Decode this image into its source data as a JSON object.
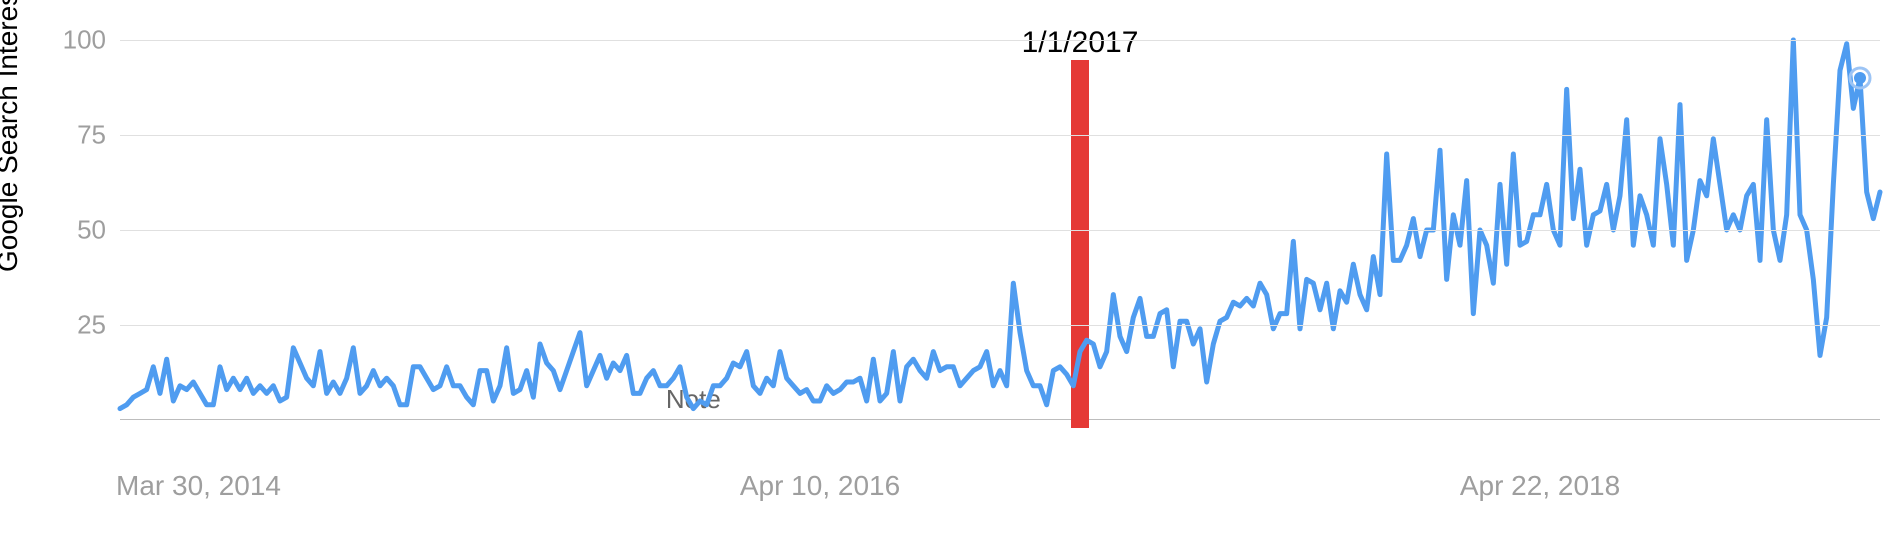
{
  "chart_data": {
    "type": "line",
    "title": "",
    "xlabel": "",
    "ylabel": "Google Search Interest",
    "ylim": [
      0,
      100
    ],
    "y_ticks": [
      25,
      50,
      75,
      100
    ],
    "x_tick_labels": [
      "Mar 30, 2014",
      "Apr 10, 2016",
      "Apr 22, 2018"
    ],
    "x_tick_indices": [
      0,
      105,
      213
    ],
    "note_label": "Note",
    "note_index": 86,
    "annotation": {
      "label": "1/1/2017",
      "index": 144
    },
    "colors": {
      "line": "#4f9cf0",
      "marker": "#e53935"
    },
    "values": [
      3,
      4,
      6,
      7,
      8,
      14,
      7,
      16,
      5,
      9,
      8,
      10,
      7,
      4,
      4,
      14,
      8,
      11,
      8,
      11,
      7,
      9,
      7,
      9,
      5,
      6,
      19,
      15,
      11,
      9,
      18,
      7,
      10,
      7,
      11,
      19,
      7,
      9,
      13,
      9,
      11,
      9,
      4,
      4,
      14,
      14,
      11,
      8,
      9,
      14,
      9,
      9,
      6,
      4,
      13,
      13,
      5,
      9,
      19,
      7,
      8,
      13,
      6,
      20,
      15,
      13,
      8,
      13,
      18,
      23,
      9,
      13,
      17,
      11,
      15,
      13,
      17,
      7,
      7,
      11,
      13,
      9,
      9,
      11,
      14,
      6,
      3,
      5,
      4,
      9,
      9,
      11,
      15,
      14,
      18,
      9,
      7,
      11,
      9,
      18,
      11,
      9,
      7,
      8,
      5,
      5,
      9,
      7,
      8,
      10,
      10,
      11,
      5,
      16,
      5,
      7,
      18,
      5,
      14,
      16,
      13,
      11,
      18,
      13,
      14,
      14,
      9,
      11,
      13,
      14,
      18,
      9,
      13,
      9,
      36,
      23,
      13,
      9,
      9,
      4,
      13,
      14,
      12,
      9,
      18,
      21,
      20,
      14,
      18,
      33,
      22,
      18,
      27,
      32,
      22,
      22,
      28,
      29,
      14,
      26,
      26,
      20,
      24,
      10,
      20,
      26,
      27,
      31,
      30,
      32,
      30,
      36,
      33,
      24,
      28,
      28,
      47,
      24,
      37,
      36,
      29,
      36,
      24,
      34,
      31,
      41,
      33,
      29,
      43,
      33,
      70,
      42,
      42,
      46,
      53,
      43,
      50,
      50,
      71,
      37,
      54,
      46,
      63,
      28,
      50,
      46,
      36,
      62,
      41,
      70,
      46,
      47,
      54,
      54,
      62,
      50,
      46,
      87,
      53,
      66,
      46,
      54,
      55,
      62,
      50,
      59,
      79,
      46,
      59,
      54,
      46,
      74,
      62,
      46,
      83,
      42,
      50,
      63,
      59,
      74,
      62,
      50,
      54,
      50,
      59,
      62,
      42,
      79,
      50,
      42,
      54,
      100,
      54,
      50,
      37,
      17,
      27,
      62,
      92,
      99,
      82,
      90,
      60,
      53,
      60
    ]
  }
}
